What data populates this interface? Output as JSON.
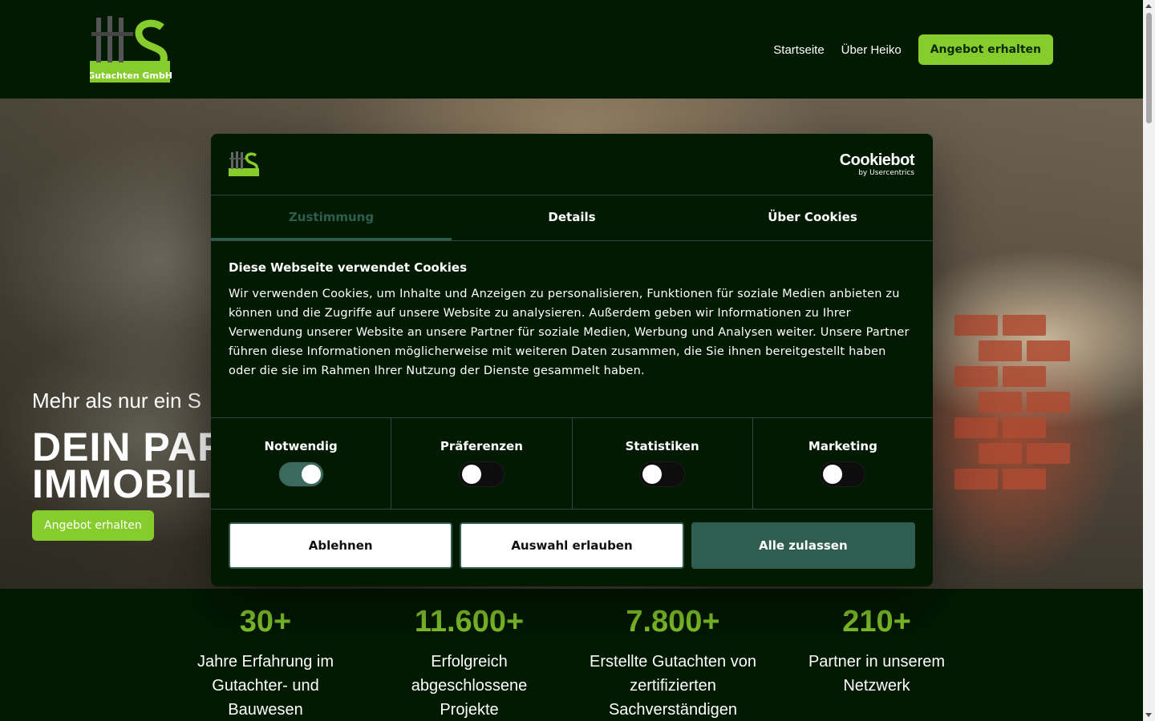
{
  "header": {
    "logo_text": "Gutachten GmbH",
    "nav": [
      "Startseite",
      "Über Heiko"
    ],
    "cta_label": "Angebot erhalten"
  },
  "hero": {
    "subtitle": "Mehr als nur ein S",
    "title_line1": "DEIN PAR",
    "title_line2": "IMMOBIL",
    "cta_label": "Angebot erhalten"
  },
  "stats": [
    {
      "value": "30+",
      "label": "Jahre Erfahrung im Gutachter- und Bauwesen"
    },
    {
      "value": "11.600+",
      "label": "Erfolgreich abgeschlossene Projekte"
    },
    {
      "value": "7.800+",
      "label": "Erstellte Gutachten von zertifizierten Sachverständigen"
    },
    {
      "value": "210+",
      "label": "Partner in unserem Netzwerk"
    }
  ],
  "cookie": {
    "brand": "Cookiebot",
    "brand_by": "by Usercentrics",
    "tabs": [
      "Zustimmung",
      "Details",
      "Über Cookies"
    ],
    "active_tab": "Zustimmung",
    "title": "Diese Webseite verwendet Cookies",
    "text": "Wir verwenden Cookies, um Inhalte und Anzeigen zu personalisieren, Funktionen für soziale Medien anbieten zu können und die Zugriffe auf unsere Website zu analysieren. Außerdem geben wir Informationen zu Ihrer Verwendung unserer Website an unsere Partner für soziale Medien, Werbung und Analysen weiter. Unsere Partner führen diese Informationen möglicherweise mit weiteren Daten zusammen, die Sie ihnen bereitgestellt haben oder die sie im Rahmen Ihrer Nutzung der Dienste gesammelt haben.",
    "toggles": [
      {
        "label": "Notwendig",
        "on": true
      },
      {
        "label": "Präferenzen",
        "on": false
      },
      {
        "label": "Statistiken",
        "on": false
      },
      {
        "label": "Marketing",
        "on": false
      }
    ],
    "buttons": {
      "decline": "Ablehnen",
      "allow_selection": "Auswahl erlauben",
      "allow_all": "Alle zulassen"
    }
  },
  "colors": {
    "background": "#021a02",
    "accent_green": "#86cc2c",
    "cookie_accent": "#2f5d4f"
  }
}
